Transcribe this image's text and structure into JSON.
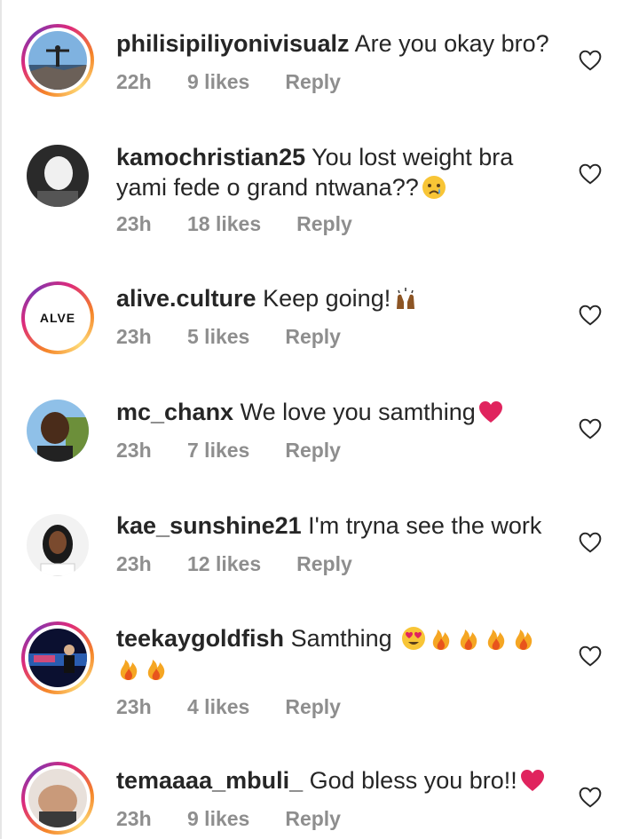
{
  "comments": [
    {
      "username": "philisipiliyonivisualz",
      "text": "Are you okay bro?",
      "time": "22h",
      "likes": "9 likes",
      "reply": "Reply",
      "avatar": "landscape-photo",
      "ring": true
    },
    {
      "username": "kamochristian25",
      "text": "You lost weight bra yami fede o grand ntwana??",
      "time": "23h",
      "likes": "18 likes",
      "reply": "Reply",
      "avatar": "person-photo",
      "ring": false,
      "emoji": [
        "crying-face"
      ]
    },
    {
      "username": "alive.culture",
      "text": "Keep going!",
      "time": "23h",
      "likes": "5 likes",
      "reply": "Reply",
      "avatar": "logo",
      "avatar_text": "ALVE",
      "ring": true,
      "emoji": [
        "raising-hands"
      ]
    },
    {
      "username": "mc_chanx",
      "text": "We love you samthing",
      "time": "23h",
      "likes": "7 likes",
      "reply": "Reply",
      "avatar": "person-photo",
      "ring": false,
      "emoji": [
        "red-heart"
      ]
    },
    {
      "username": "kae_sunshine21",
      "text": "I'm tryna see the work",
      "time": "23h",
      "likes": "12 likes",
      "reply": "Reply",
      "avatar": "person-photo",
      "ring": false
    },
    {
      "username": "teekaygoldfish",
      "text": "Samthing",
      "time": "23h",
      "likes": "4 likes",
      "reply": "Reply",
      "avatar": "stage-photo",
      "ring": true,
      "emoji": [
        "heart-eyes",
        "fire",
        "fire",
        "fire",
        "fire",
        "fire",
        "fire"
      ]
    },
    {
      "username": "temaaaa_mbuli_",
      "text": "God bless you bro!!",
      "time": "23h",
      "likes": "9 likes",
      "reply": "Reply",
      "avatar": "person-photo",
      "ring": true,
      "emoji": [
        "red-heart"
      ]
    }
  ],
  "colors": {
    "text": "#262626",
    "meta": "#8e8e8e",
    "heart_red": "#e0245e",
    "fire": "#f5a623"
  },
  "icons": {
    "like": "heart-outline-icon"
  }
}
